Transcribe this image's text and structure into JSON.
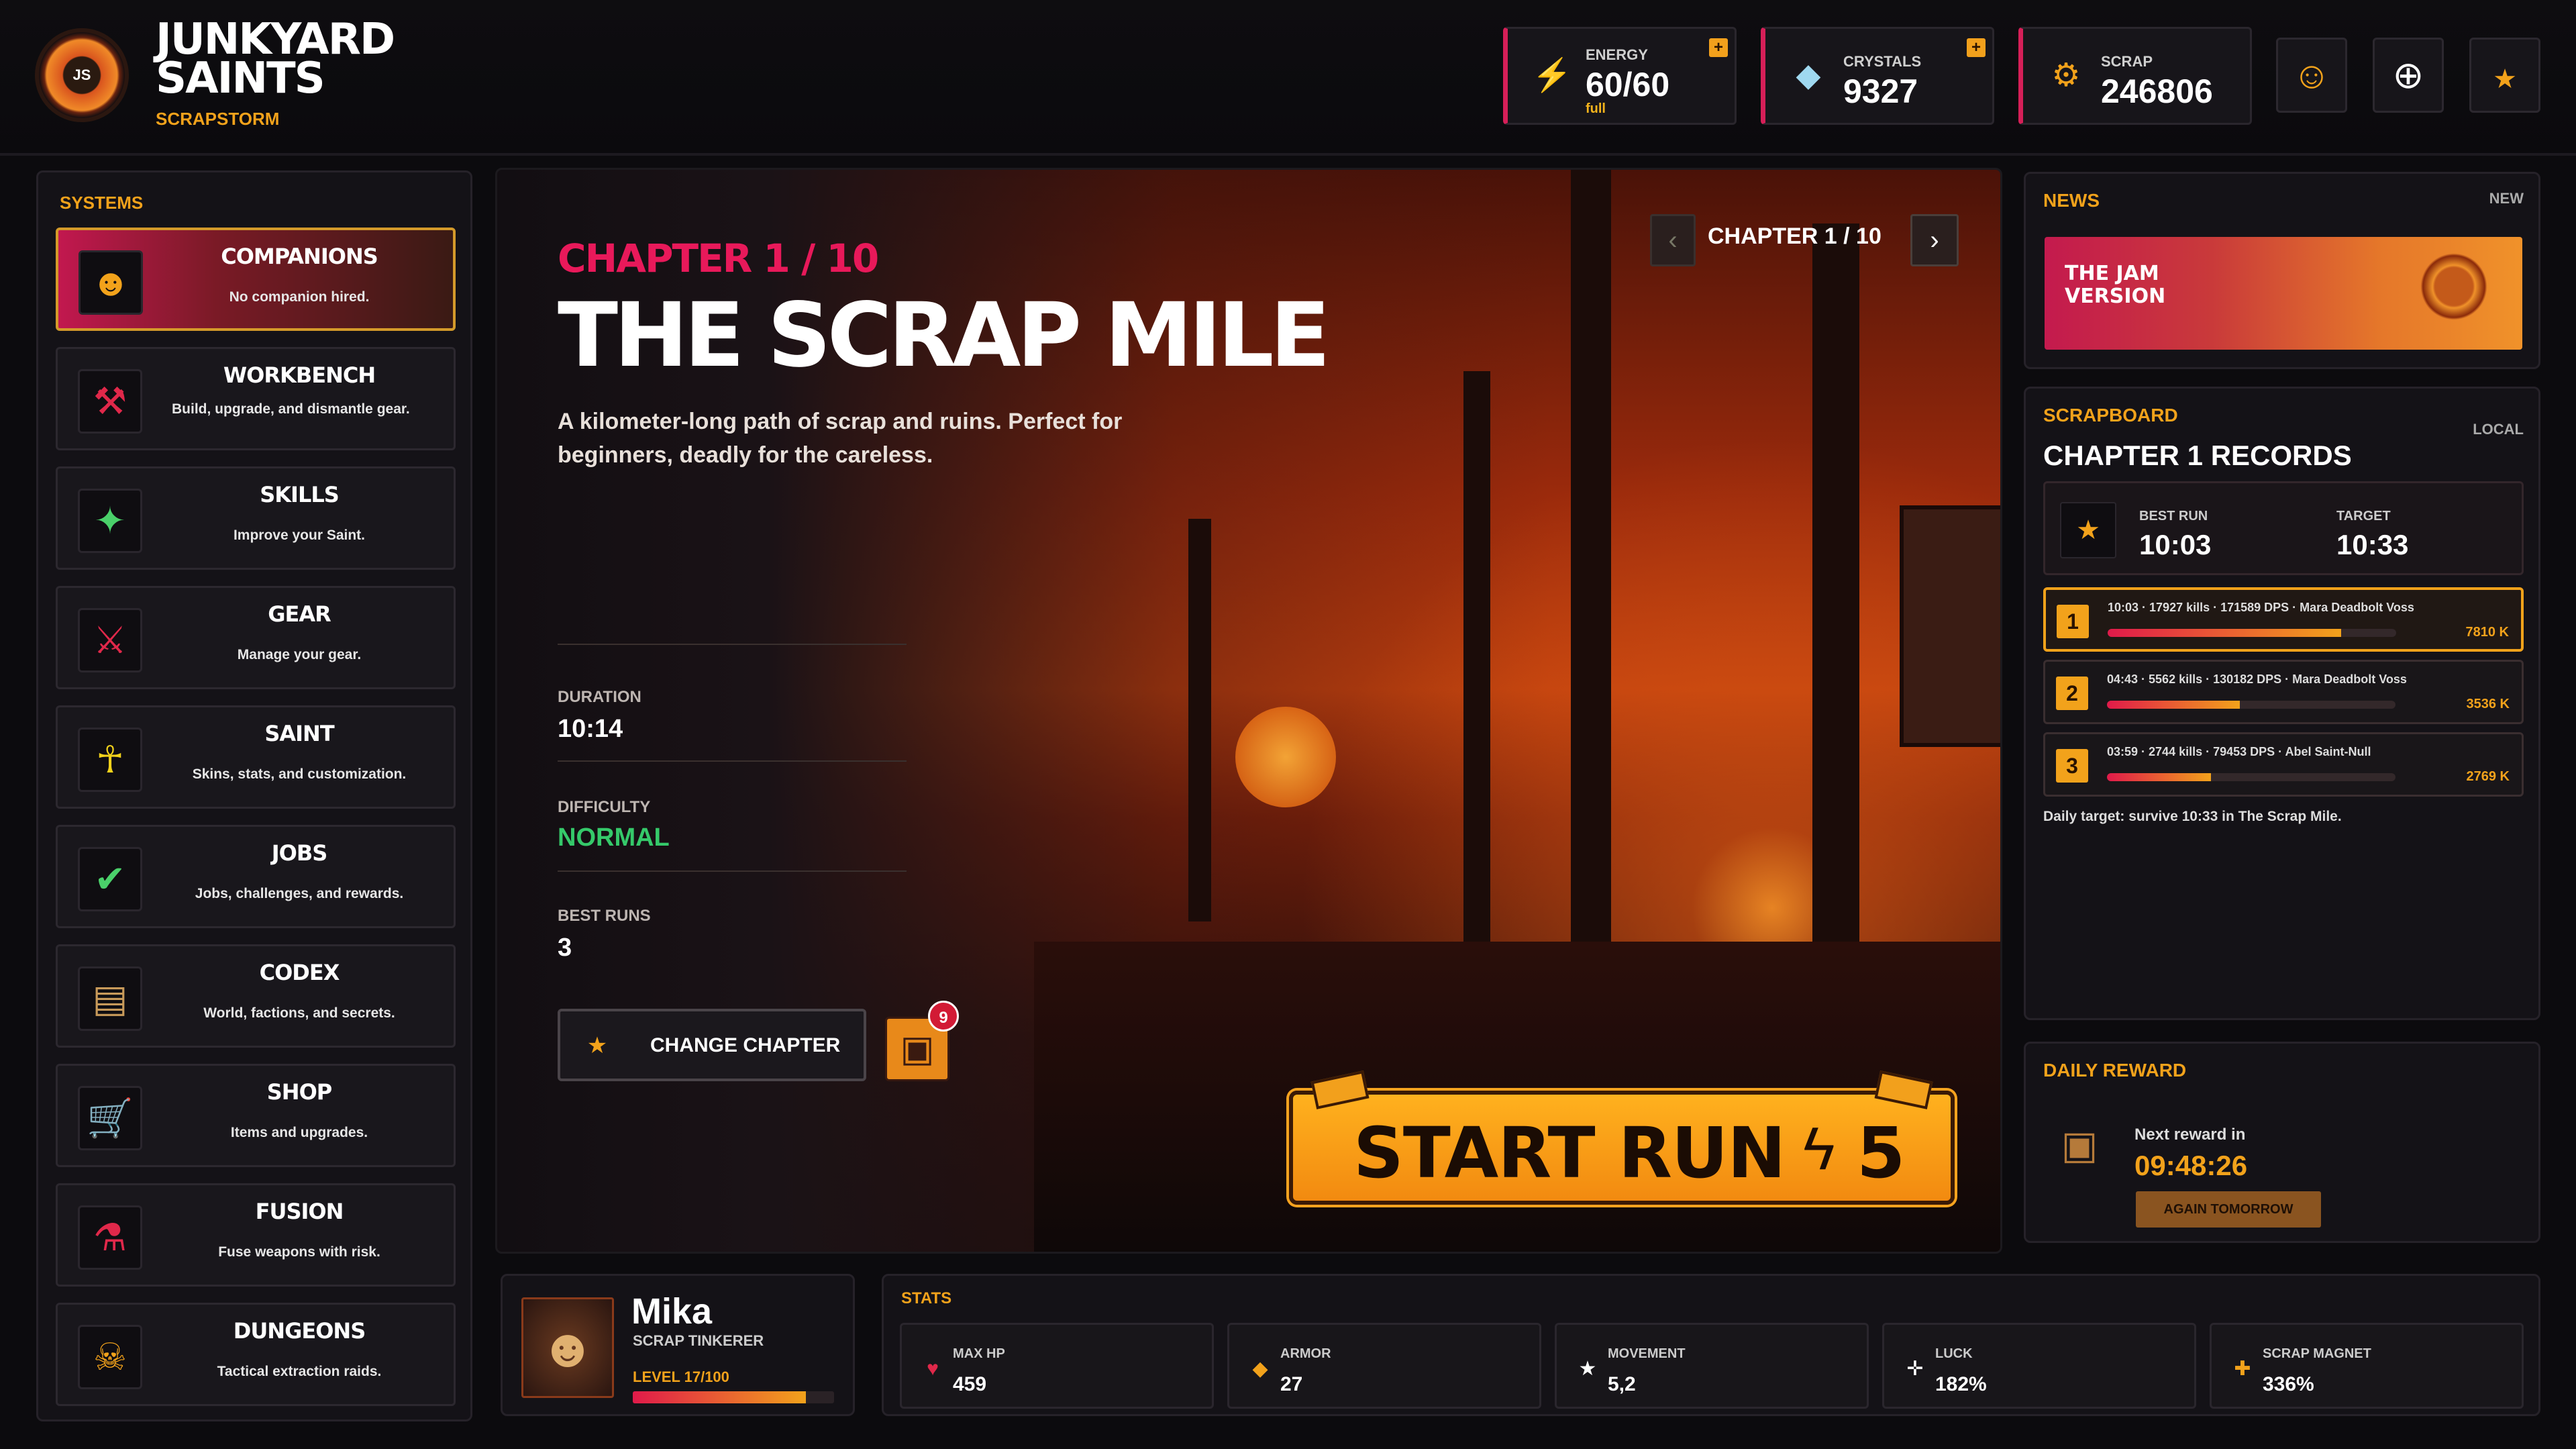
{
  "brand": {
    "name": "JUNKYARD SAINTS",
    "subtitle": "SCRAPSTORM",
    "logo_text": "JS"
  },
  "resources": [
    {
      "label": "ENERGY",
      "value": "60/60",
      "sub": "full",
      "icon": "bolt-icon",
      "plus": "+"
    },
    {
      "label": "CRYSTALS",
      "value": "9327",
      "icon": "crystal-icon",
      "plus": "+"
    },
    {
      "label": "SCRAP",
      "value": "246806",
      "icon": "scrap-icon"
    }
  ],
  "header_buttons": [
    "settings-icon",
    "target-icon",
    "profile-icon"
  ],
  "sidebar": {
    "title": "SYSTEMS",
    "items": [
      {
        "name": "COMPANIONS",
        "desc": "No companion hired.",
        "icon": "companion-icon",
        "active": true
      },
      {
        "name": "WORKBENCH",
        "desc": "Build, upgrade, and dismantle gear.",
        "icon": "workbench-icon"
      },
      {
        "name": "SKILLS",
        "desc": "Improve your Saint.",
        "icon": "skills-icon"
      },
      {
        "name": "GEAR",
        "desc": "Manage your gear.",
        "icon": "gear-icon"
      },
      {
        "name": "SAINT",
        "desc": "Skins, stats, and customization.",
        "icon": "saint-icon"
      },
      {
        "name": "JOBS",
        "desc": "Jobs, challenges, and rewards.",
        "icon": "jobs-icon"
      },
      {
        "name": "CODEX",
        "desc": "World, factions, and secrets.",
        "icon": "codex-icon"
      },
      {
        "name": "SHOP",
        "desc": "Items and upgrades.",
        "icon": "shop-icon"
      },
      {
        "name": "FUSION",
        "desc": "Fuse weapons with risk.",
        "icon": "fusion-icon"
      },
      {
        "name": "DUNGEONS",
        "desc": "Tactical extraction raids.",
        "icon": "dungeons-icon"
      }
    ]
  },
  "chapter": {
    "tag": "CHAPTER 1 / 10",
    "title": "THE SCRAP MILE",
    "description": "A kilometer-long path of scrap and ruins. Perfect for beginners, deadly for the careless.",
    "nav_label": "CHAPTER 1 / 10",
    "prev": "‹",
    "next": "›",
    "duration_label": "DURATION",
    "duration": "10:14",
    "difficulty_label": "DIFFICULTY",
    "difficulty": "NORMAL",
    "difficulty_color": "#35c96a",
    "best_runs_label": "BEST RUNS",
    "best_runs": "3",
    "change_label": "CHANGE CHAPTER",
    "chest_badge": "9",
    "start_label": "START RUN",
    "start_cost": "5"
  },
  "news": {
    "title": "NEWS",
    "badge": "NEW",
    "banner": "THE JAM VERSION"
  },
  "scrapboard": {
    "tag": "SCRAPBOARD",
    "scope": "LOCAL",
    "title": "CHAPTER 1 RECORDS",
    "best_label": "BEST RUN",
    "best_value": "10:03",
    "target_label": "TARGET",
    "target_value": "10:33",
    "records": [
      {
        "rank": "1",
        "info": "10:03 · 17927 kills · 171589 DPS · Mara Deadbolt Voss",
        "points": "7810 K",
        "progress": 0.81
      },
      {
        "rank": "2",
        "info": "04:43 · 5562 kills · 130182 DPS · Mara Deadbolt Voss",
        "points": "3536 K",
        "progress": 0.46
      },
      {
        "rank": "3",
        "info": "03:59 · 2744 kills · 79453 DPS · Abel Saint-Null",
        "points": "2769 K",
        "progress": 0.36
      }
    ],
    "daily_target": "Daily target: survive 10:33 in The Scrap Mile."
  },
  "daily_reward": {
    "title": "DAILY REWARD",
    "next_label": "Next reward in",
    "timer": "09:48:26",
    "button": "AGAIN TOMORROW"
  },
  "hero": {
    "name": "Mika",
    "class": "SCRAP TINKERER",
    "level": "LEVEL 17/100",
    "xp": 0.86
  },
  "stats": {
    "title": "STATS",
    "items": [
      {
        "label": "MAX HP",
        "value": "459",
        "icon": "heart-icon",
        "color": "#e0284a"
      },
      {
        "label": "ARMOR",
        "value": "27",
        "icon": "armor-icon",
        "color": "#f2a21b"
      },
      {
        "label": "MOVEMENT",
        "value": "5,2",
        "icon": "star-icon",
        "color": "#ffffff"
      },
      {
        "label": "LUCK",
        "value": "182%",
        "icon": "luck-icon",
        "color": "#ffffff"
      },
      {
        "label": "SCRAP MAGNET",
        "value": "336%",
        "icon": "magnet-icon",
        "color": "#f2a21b"
      }
    ]
  }
}
